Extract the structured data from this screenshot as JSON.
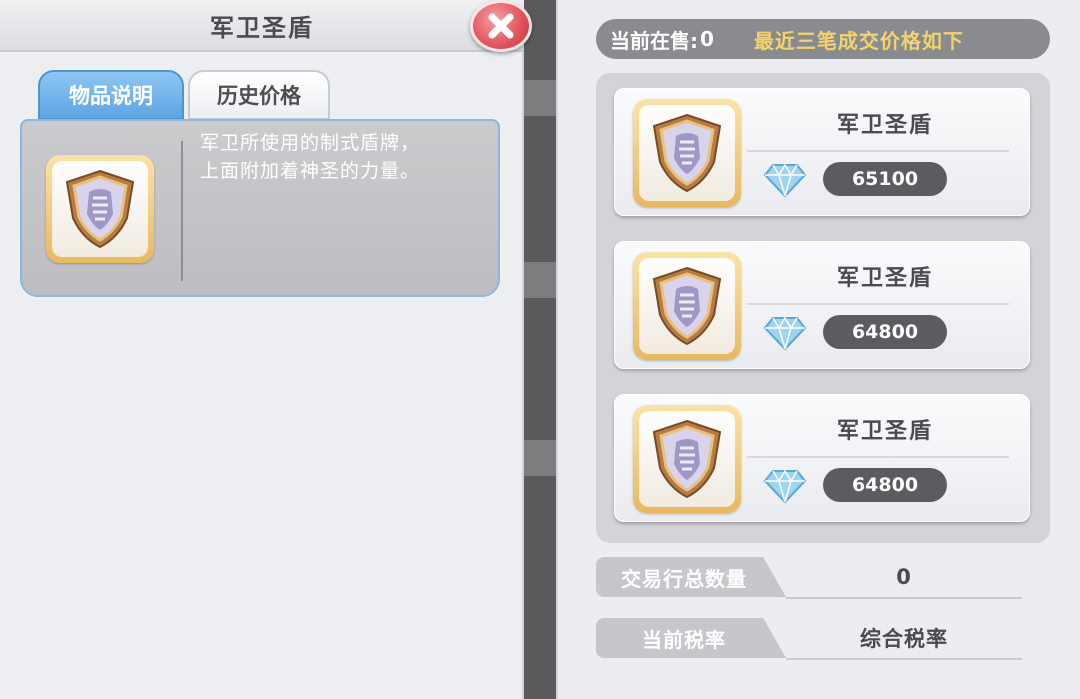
{
  "left_panel": {
    "title": "军卫圣盾",
    "close_icon": "close-icon",
    "tabs": [
      {
        "label": "物品说明",
        "active": true
      },
      {
        "label": "历史价格",
        "active": false
      }
    ],
    "item": {
      "icon": "shield-icon",
      "description_line1": "军卫所使用的制式盾牌，",
      "description_line2": "上面附加着神圣的力量。"
    }
  },
  "right_panel": {
    "on_sale_label": "当前在售:",
    "on_sale_count": "0",
    "recent_note": "最近三笔成交价格如下",
    "listings": [
      {
        "name": "军卫圣盾",
        "currency_icon": "diamond-icon",
        "price": "65100"
      },
      {
        "name": "军卫圣盾",
        "currency_icon": "diamond-icon",
        "price": "64800"
      },
      {
        "name": "军卫圣盾",
        "currency_icon": "diamond-icon",
        "price": "64800"
      }
    ],
    "total_volume": {
      "label": "交易行总数量",
      "value": "0"
    },
    "tax": {
      "label": "当前税率",
      "value": "综合税率"
    }
  },
  "colors": {
    "active_tab": "#5da5e2",
    "close_button": "#e0525b",
    "price_pill": "#5c5c60",
    "note_text": "#f3d36e"
  }
}
